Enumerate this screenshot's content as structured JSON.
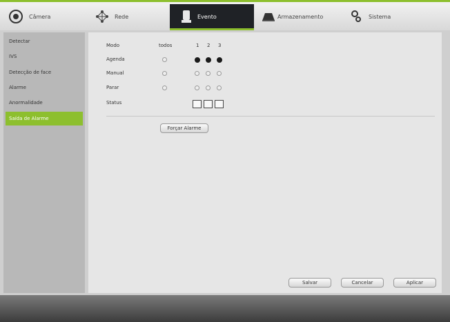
{
  "tabs": [
    {
      "label": "Câmera",
      "icon": "camera-icon"
    },
    {
      "label": "Rede",
      "icon": "network-icon"
    },
    {
      "label": "Evento",
      "icon": "event-icon"
    },
    {
      "label": "Armazenamento",
      "icon": "storage-icon"
    },
    {
      "label": "Sistema",
      "icon": "system-icon"
    }
  ],
  "active_tab": "Evento",
  "sidebar": {
    "items": [
      {
        "label": "Detectar"
      },
      {
        "label": "IVS"
      },
      {
        "label": "Detecção de face"
      },
      {
        "label": "Alarme"
      },
      {
        "label": "Anormalidade"
      },
      {
        "label": "Saída de Alarme"
      }
    ],
    "active": "Saída de Alarme"
  },
  "form": {
    "header": {
      "mode": "Modo",
      "all": "todos",
      "channels": [
        "1",
        "2",
        "3"
      ]
    },
    "rows": [
      {
        "label": "Agenda",
        "all": false,
        "channels": [
          true,
          true,
          true
        ]
      },
      {
        "label": "Manual",
        "all": false,
        "channels": [
          false,
          false,
          false
        ]
      },
      {
        "label": "Parar",
        "all": false,
        "channels": [
          false,
          false,
          false
        ]
      }
    ],
    "status_label": "Status",
    "force_button": "Forçar Alarme"
  },
  "footer": {
    "save": "Salvar",
    "cancel": "Cancelar",
    "apply": "Aplicar"
  },
  "colors": {
    "accent": "#8dbf2e",
    "active_tab_bg": "#1f2226"
  }
}
